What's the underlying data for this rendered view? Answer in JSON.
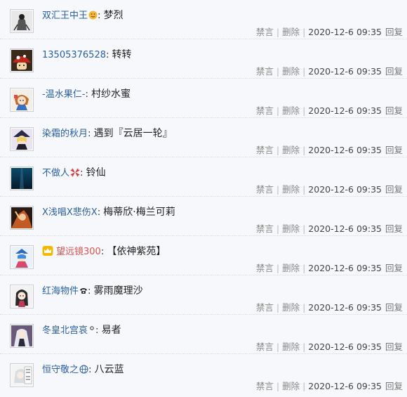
{
  "actions": {
    "ban": "禁言",
    "delete": "删除",
    "reply": "回复"
  },
  "comments": [
    {
      "user": "双汇王中王",
      "badge": "smiley-badge-icon",
      "content": "梦烈",
      "time": "2020-12-6 09:35"
    },
    {
      "user": "13505376528",
      "content": "转转",
      "time": "2020-12-6 09:35"
    },
    {
      "user": "-温水果仁-",
      "content": "村纱水蜜",
      "time": "2020-12-6 09:35"
    },
    {
      "user": "染霜的秋月",
      "content": "遇到『云居一轮』",
      "time": "2020-12-6 09:35"
    },
    {
      "user": "不做人",
      "badge": "anger-badge-icon",
      "content": "铃仙",
      "time": "2020-12-6 09:35"
    },
    {
      "user": "X浅唱X悲伤X",
      "content": "梅蒂欣·梅兰可莉",
      "time": "2020-12-6 09:35"
    },
    {
      "user": "望远镜300",
      "badge": "vip-crown-icon",
      "user_color": "#d9534f",
      "content": "【依神紫苑】",
      "time": "2020-12-6 09:35"
    },
    {
      "user": "红海物件",
      "badge": "phone-badge-icon",
      "content": "雾雨魔理沙",
      "time": "2020-12-6 09:35"
    },
    {
      "user": "冬皇北宫哀",
      "badge": "degree-badge-icon",
      "content": "易者",
      "time": "2020-12-6 09:35"
    },
    {
      "user": "恒守敬之",
      "badge": "globe-badge-icon",
      "content": "八云蓝",
      "time": "2020-12-6 09:35"
    }
  ]
}
